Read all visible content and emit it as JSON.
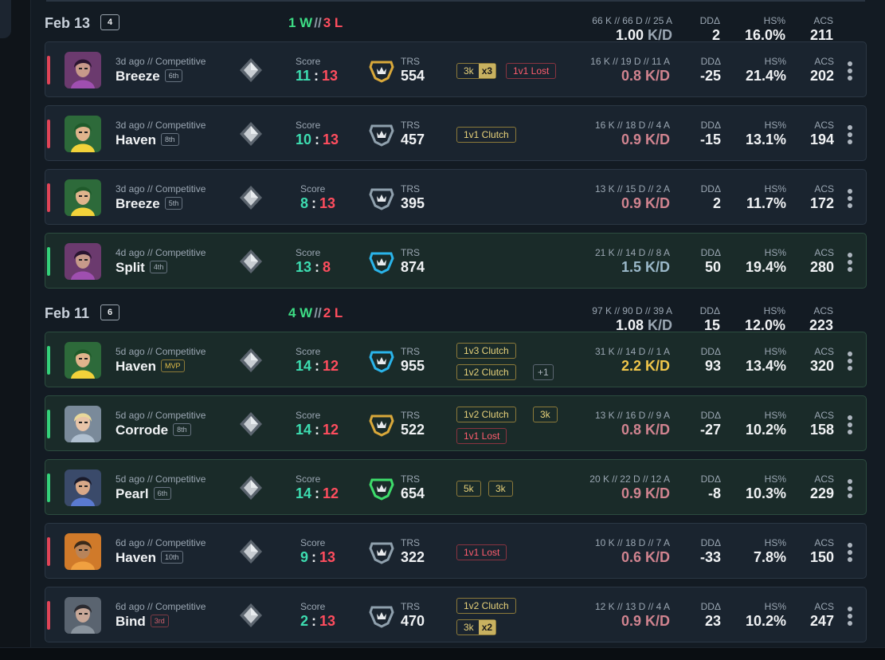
{
  "days": [
    {
      "date": "Feb 13",
      "count": "4",
      "wins": "1 W",
      "sep": "//",
      "losses": "3 L",
      "kda": "66 K // 66 D // 25 A",
      "kd": "1.00",
      "kd_unit": "K/D",
      "dd": "2",
      "hs": "16.0%",
      "acs": "211",
      "labels": {
        "dd": "DDΔ",
        "hs": "HS%",
        "acs": "ACS"
      }
    },
    {
      "date": "Feb 11",
      "count": "6",
      "wins": "4 W",
      "sep": "//",
      "losses": "2 L",
      "kda": "97 K // 90 D // 39 A",
      "kd": "1.08",
      "kd_unit": "K/D",
      "dd": "15",
      "hs": "12.0%",
      "acs": "223",
      "labels": {
        "dd": "DDΔ",
        "hs": "HS%",
        "acs": "ACS"
      }
    }
  ],
  "labels": {
    "score": "Score",
    "trs": "TRS",
    "dd": "DDΔ",
    "hs": "HS%",
    "acs": "ACS",
    "colon": ":"
  },
  "matches": [
    {
      "result": "loss",
      "agent": "purple",
      "meta": "3d ago // Competitive",
      "map": "Breeze",
      "place": "6th",
      "score_a": "11",
      "score_b": "13",
      "trs_color": "#d9a83a",
      "trs": "554",
      "tags": [
        {
          "text": "3k",
          "mult": "x3"
        },
        {
          "text": "1v1 Lost",
          "type": "lost"
        }
      ],
      "kda": "16 K // 19 D // 11 A",
      "kd": "0.8 K/D",
      "dd": "-25",
      "hs": "21.4%",
      "acs": "202"
    },
    {
      "result": "loss",
      "agent": "green",
      "meta": "3d ago // Competitive",
      "map": "Haven",
      "place": "8th",
      "score_a": "10",
      "score_b": "13",
      "trs_color": "#8fa0ad",
      "trs": "457",
      "tags": [
        {
          "text": "1v1 Clutch"
        }
      ],
      "kda": "16 K // 18 D // 4 A",
      "kd": "0.9 K/D",
      "dd": "-15",
      "hs": "13.1%",
      "acs": "194"
    },
    {
      "result": "loss",
      "agent": "green",
      "meta": "3d ago // Competitive",
      "map": "Breeze",
      "place": "5th",
      "score_a": "8",
      "score_b": "13",
      "trs_color": "#8fa0ad",
      "trs": "395",
      "tags": [],
      "kda": "13 K // 15 D // 2 A",
      "kd": "0.9 K/D",
      "dd": "2",
      "hs": "11.7%",
      "acs": "172"
    },
    {
      "result": "win",
      "agent": "purple",
      "meta": "4d ago // Competitive",
      "map": "Split",
      "place": "4th",
      "score_a": "13",
      "score_b": "8",
      "trs_color": "#2ab4ea",
      "trs": "874",
      "tags": [],
      "kda": "21 K // 14 D // 8 A",
      "kd": "1.5 K/D",
      "kd_style": "good",
      "dd": "50",
      "hs": "19.4%",
      "acs": "280"
    },
    {
      "result": "win",
      "agent": "green",
      "meta": "5d ago // Competitive",
      "map": "Haven",
      "place": "MVP",
      "place_style": "mvp",
      "score_a": "14",
      "score_b": "12",
      "trs_color": "#2ab4ea",
      "trs": "955",
      "tags": [
        {
          "text": "1v3 Clutch",
          "row": 0
        },
        {
          "text": "1v2 Clutch",
          "row": 1
        },
        {
          "text": "+1",
          "type": "plus",
          "row": 1
        }
      ],
      "kda": "31 K // 14 D // 1 A",
      "kd": "2.2 K/D",
      "kd_style": "great",
      "dd": "93",
      "hs": "13.4%",
      "acs": "320"
    },
    {
      "result": "win",
      "agent": "blonde",
      "meta": "5d ago // Competitive",
      "map": "Corrode",
      "place": "8th",
      "score_a": "14",
      "score_b": "12",
      "trs_color": "#d9a83a",
      "trs": "522",
      "tags": [
        {
          "text": "1v2 Clutch",
          "row": 0
        },
        {
          "text": "3k",
          "row": 0
        },
        {
          "text": "1v1 Lost",
          "type": "lost",
          "row": 1
        }
      ],
      "kda": "13 K // 16 D // 9 A",
      "kd": "0.8 K/D",
      "dd": "-27",
      "hs": "10.2%",
      "acs": "158"
    },
    {
      "result": "win",
      "agent": "dark",
      "meta": "5d ago // Competitive",
      "map": "Pearl",
      "place": "6th",
      "score_a": "14",
      "score_b": "12",
      "trs_color": "#3ddc6a",
      "trs": "654",
      "tags": [
        {
          "text": "5k"
        },
        {
          "text": "3k"
        }
      ],
      "kda": "20 K // 22 D // 12 A",
      "kd": "0.9 K/D",
      "dd": "-8",
      "hs": "10.3%",
      "acs": "229"
    },
    {
      "result": "loss",
      "agent": "orange",
      "meta": "6d ago // Competitive",
      "map": "Haven",
      "place": "10th",
      "score_a": "9",
      "score_b": "13",
      "trs_color": "#8fa0ad",
      "trs": "322",
      "tags": [
        {
          "text": "1v1 Lost",
          "type": "lost"
        }
      ],
      "kda": "10 K // 18 D // 7 A",
      "kd": "0.6 K/D",
      "dd": "-33",
      "hs": "7.8%",
      "acs": "150"
    },
    {
      "result": "loss",
      "agent": "grey",
      "meta": "6d ago // Competitive",
      "map": "Bind",
      "place": "3rd",
      "place_style": "low",
      "score_a": "2",
      "score_b": "13",
      "trs_color": "#8fa0ad",
      "trs": "470",
      "tags": [
        {
          "text": "1v2 Clutch",
          "row": 0
        },
        {
          "text": "3k",
          "mult": "x2",
          "row": 1
        }
      ],
      "kda": "12 K // 13 D // 4 A",
      "kd": "0.9 K/D",
      "dd": "23",
      "hs": "10.2%",
      "acs": "247"
    }
  ]
}
